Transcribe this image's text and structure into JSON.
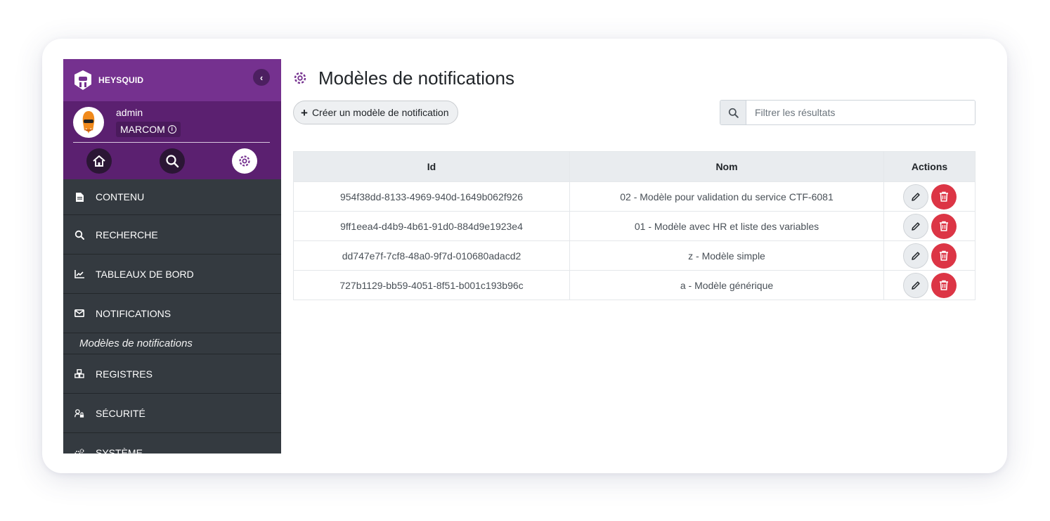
{
  "brand": {
    "name": "HEYSQUID"
  },
  "user": {
    "name": "admin",
    "organization": "MARCOM"
  },
  "quick_nav": [
    {
      "icon": "home-icon"
    },
    {
      "icon": "search-icon"
    },
    {
      "icon": "gear-icon",
      "active": true
    }
  ],
  "menu": {
    "items": [
      {
        "label": "CONTENU",
        "icon": "document-icon"
      },
      {
        "label": "RECHERCHE",
        "icon": "search-icon"
      },
      {
        "label": "TABLEAUX DE BORD",
        "icon": "chart-line-icon"
      },
      {
        "label": "NOTIFICATIONS",
        "icon": "envelope-icon"
      },
      {
        "label": "REGISTRES",
        "icon": "cubes-icon"
      },
      {
        "label": "SÉCURITÉ",
        "icon": "user-lock-icon"
      },
      {
        "label": "SYSTÈME",
        "icon": "gears-icon"
      }
    ],
    "submenu": {
      "label": "Modèles de notifications"
    }
  },
  "page": {
    "title": "Modèles de notifications",
    "create_label": "Créer un modèle de notification",
    "search_placeholder": "Filtrer les résultats"
  },
  "table": {
    "headers": {
      "id": "Id",
      "name": "Nom",
      "actions": "Actions"
    },
    "rows": [
      {
        "id": "954f38dd-8133-4969-940d-1649b062f926",
        "name": "02 - Modèle pour validation du service CTF-6081"
      },
      {
        "id": "9ff1eea4-d4b9-4b61-91d0-884d9e1923e4",
        "name": "01 - Modèle avec HR et liste des variables"
      },
      {
        "id": "dd747e7f-7cf8-48a0-9f7d-010680adacd2",
        "name": "z - Modèle simple"
      },
      {
        "id": "727b1129-bb59-4051-8f51-b001c193b96c",
        "name": "a - Modèle générique"
      }
    ]
  },
  "colors": {
    "brand": "#75318f",
    "brand_dark": "#5b2070",
    "sidebar": "#343a40",
    "danger": "#dc3545"
  }
}
